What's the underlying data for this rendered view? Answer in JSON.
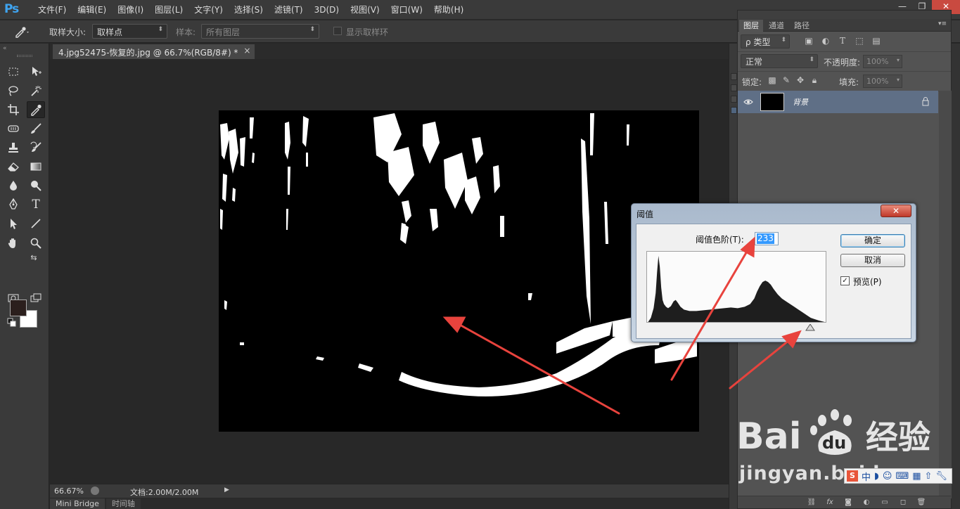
{
  "app": {
    "logo": "Ps",
    "menu": [
      "文件(F)",
      "编辑(E)",
      "图像(I)",
      "图层(L)",
      "文字(Y)",
      "选择(S)",
      "滤镜(T)",
      "3D(D)",
      "视图(V)",
      "窗口(W)",
      "帮助(H)"
    ],
    "window_controls": [
      "—",
      "❐",
      "✕"
    ]
  },
  "options": {
    "sample_size_label": "取样大小:",
    "sample_size_value": "取样点",
    "sample_label": "样本:",
    "sample_value": "所有图层",
    "show_ring_label": "显示取样环"
  },
  "document": {
    "tab_title": "4.jpg52475-恢复的.jpg @ 66.7%(RGB/8#) *",
    "tab_close": "×",
    "zoom": "66.67%",
    "doc_size": "文档:2.00M/2.00M",
    "bottom_tabs": [
      "Mini Bridge",
      "时间轴"
    ]
  },
  "layers_panel": {
    "tabs": [
      "图层",
      "通道",
      "路径"
    ],
    "filter_label": "ρ 类型",
    "blend_mode": "正常",
    "opacity_label": "不透明度:",
    "opacity_value": "100%",
    "lock_label": "锁定:",
    "fill_label": "填充:",
    "fill_value": "100%",
    "layers": [
      {
        "name": "背景",
        "visible": true,
        "locked": true
      }
    ],
    "footer_icons": [
      "link-icon",
      "fx-icon",
      "mask-icon",
      "adjustment-icon",
      "group-icon",
      "new-layer-icon",
      "trash-icon"
    ]
  },
  "dialog": {
    "title": "阈值",
    "close": "✕",
    "threshold_label": "阈值色阶(T):",
    "threshold_value": "233",
    "ok_label": "确定",
    "cancel_label": "取消",
    "preview_label": "预览(P)",
    "preview_checked": true,
    "histogram": {
      "x_range": [
        0,
        255
      ],
      "peak_color": "#1e1e1e"
    }
  },
  "watermark": {
    "brand": "Bai du 经验",
    "url": "jingyan.baidu.com"
  },
  "ime": {
    "mode": "中"
  },
  "colors": {
    "foreground": "#2b1f1d",
    "background": "#ffffff",
    "annotation": "#e8433d",
    "selected_layer": "#5f6f86"
  }
}
